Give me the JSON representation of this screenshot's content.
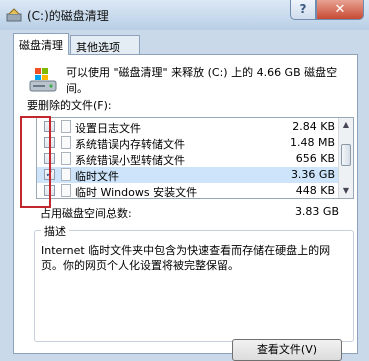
{
  "window": {
    "title": "(C:)的磁盘清理",
    "close_label": "✕",
    "help_label": "?"
  },
  "tabs": [
    {
      "label": "磁盘清理"
    },
    {
      "label": "其他选项"
    }
  ],
  "intro_text": "可以使用 \"磁盘清理\" 来释放 (C:) 上的 4.66 GB 磁盘空间。",
  "files_label": "要删除的文件(F):",
  "files": [
    {
      "name": "设置日志文件",
      "size": "2.84 KB",
      "checked": false
    },
    {
      "name": "系统错误内存转储文件",
      "size": "1.48 MB",
      "checked": false
    },
    {
      "name": "系统错误小型转储文件",
      "size": "656 KB",
      "checked": false
    },
    {
      "name": "临时文件",
      "size": "3.36 GB",
      "checked": true
    },
    {
      "name": "临时 Windows 安装文件",
      "size": "448 KB",
      "checked": false
    }
  ],
  "total": {
    "label": "占用磁盘空间总数:",
    "value": "3.83 GB"
  },
  "description": {
    "title": "描述",
    "text": "Internet 临时文件夹中包含为快速查看而存储在硬盘上的网页。你的网页个人化设置将被完整保留。"
  },
  "view_files_button": "查看文件(V)",
  "colors": {
    "accent_red": "#c1272d",
    "selection": "#cde4fa"
  }
}
